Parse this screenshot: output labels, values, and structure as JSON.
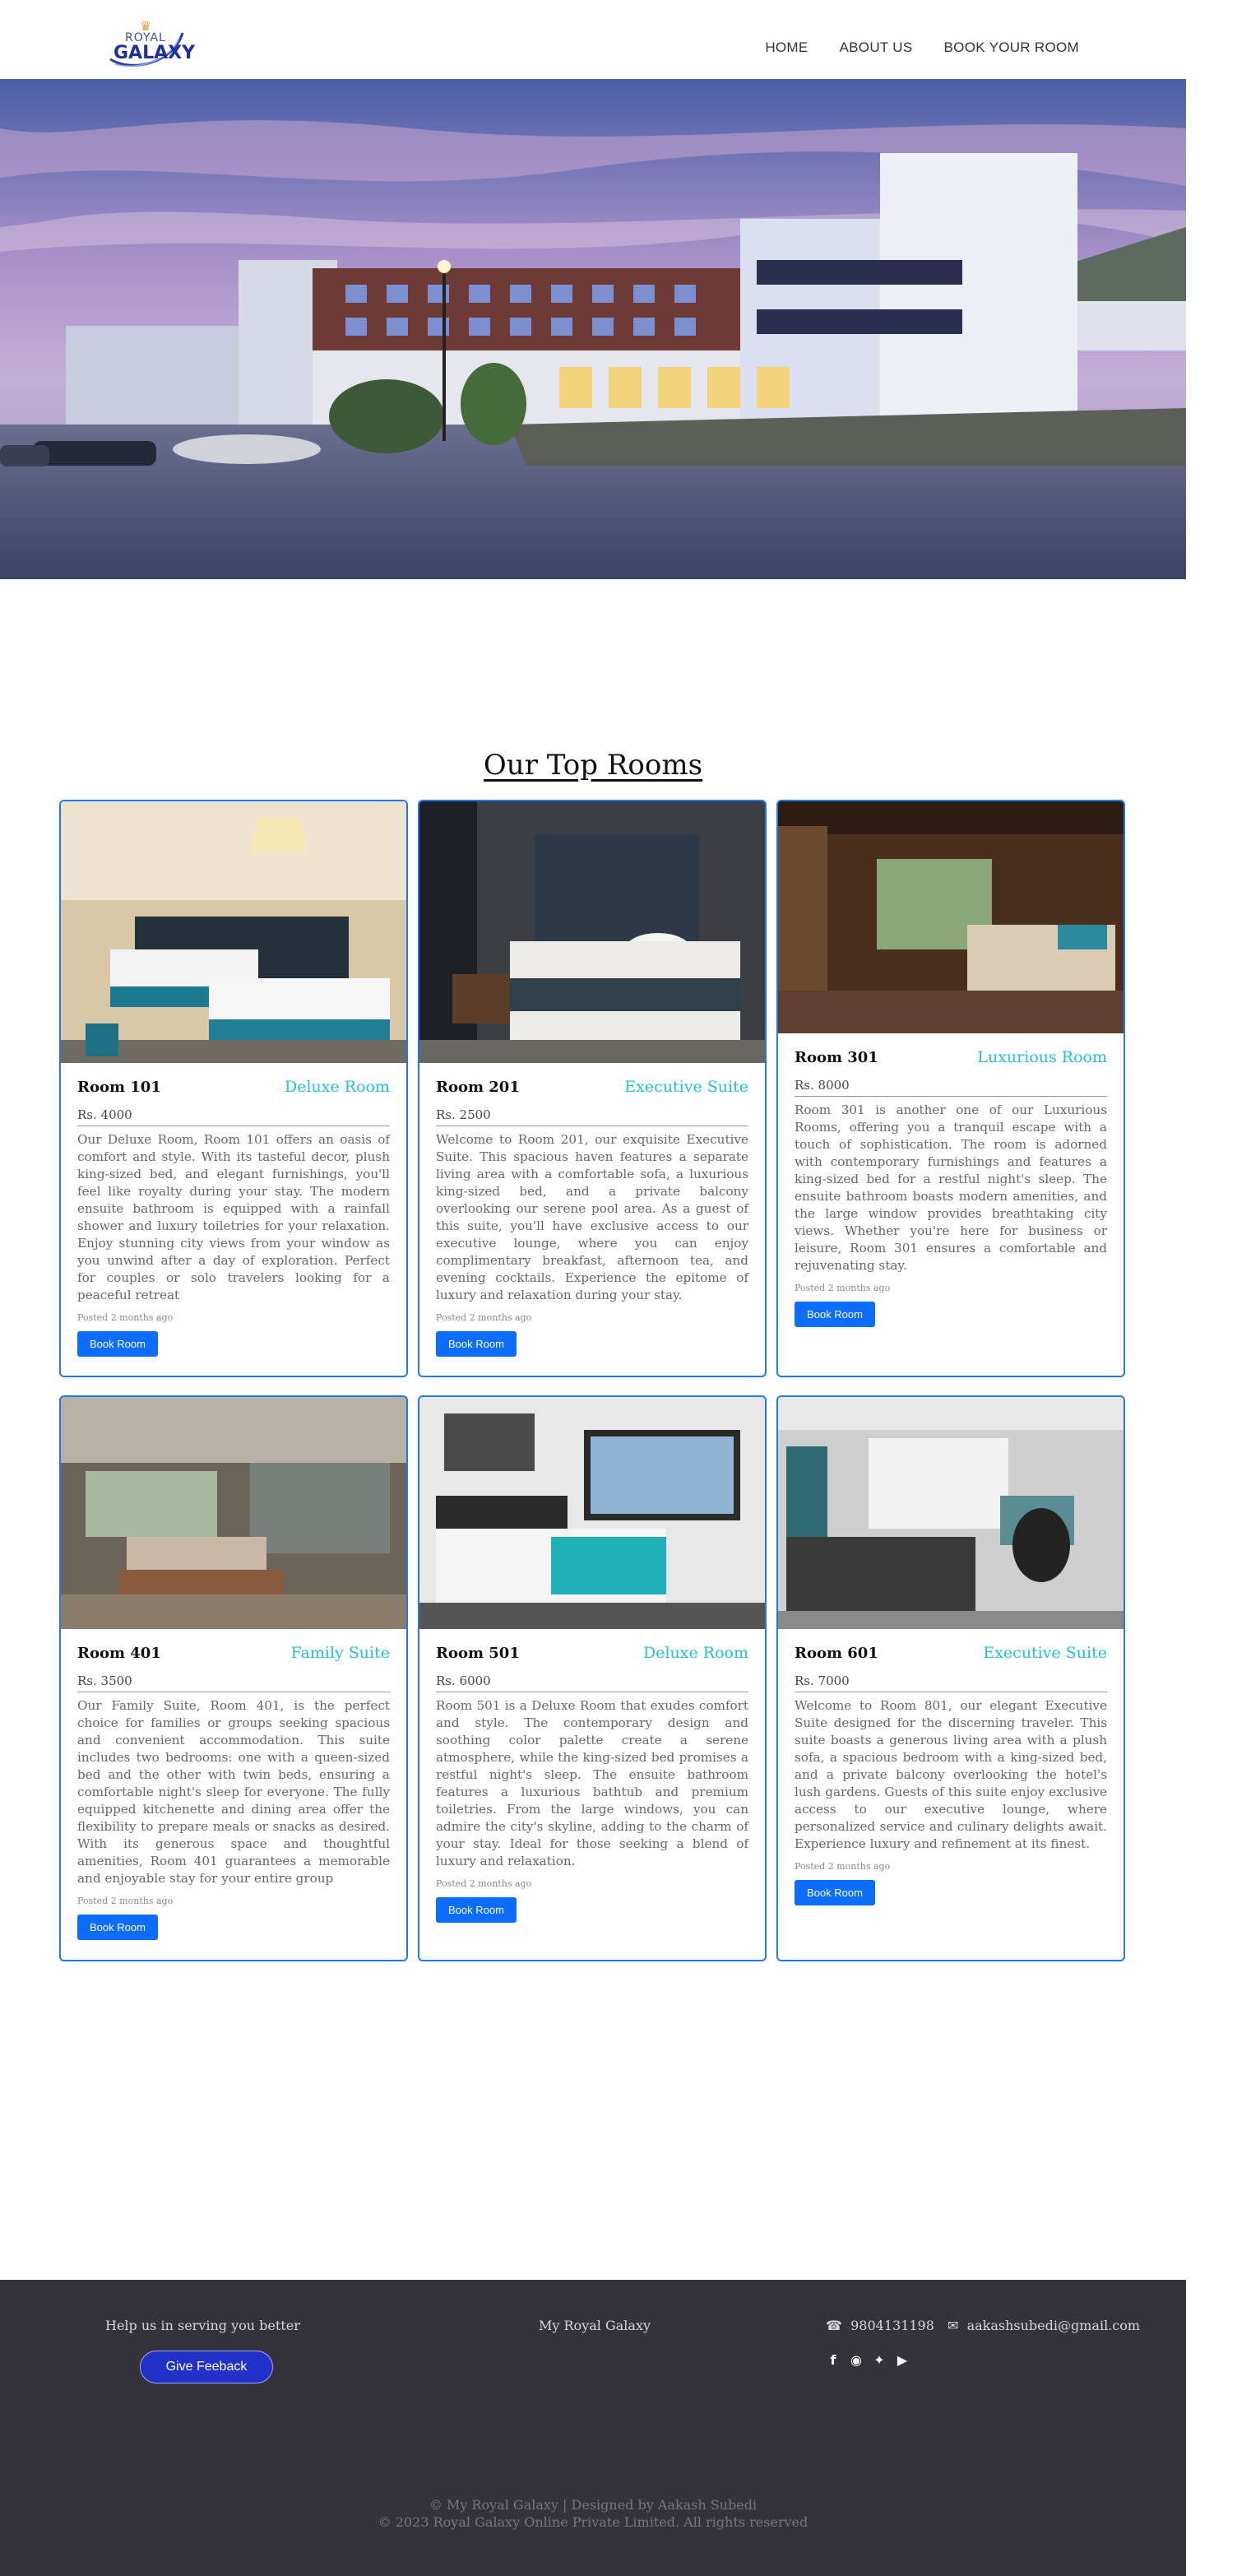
{
  "brand": {
    "logo_top": "ROYAL",
    "logo_bottom": "GALAXY"
  },
  "nav": {
    "items": [
      "HOME",
      "ABOUT US",
      "BOOK YOUR ROOM"
    ]
  },
  "hero": {
    "slides": 5
  },
  "section": {
    "title": "Our Top Rooms"
  },
  "rooms": [
    {
      "name": "Room 101",
      "type": "Deluxe Room",
      "price": "Rs. 4000",
      "description": "Our Deluxe Room, Room 101 offers an oasis of comfort and style. With its tasteful decor, plush king-sized bed, and elegant furnishings, you'll feel like royalty during your stay. The modern ensuite bathroom is equipped with a rainfall shower and luxury toiletries for your relaxation. Enjoy stunning city views from your window as you unwind after a day of exploration. Perfect for couples or solo travelers looking for a peaceful retreat",
      "posted": "Posted 2 months ago",
      "button": "Book Room"
    },
    {
      "name": "Room 201",
      "type": "Executive Suite",
      "price": "Rs. 2500",
      "description": "Welcome to Room 201, our exquisite Executive Suite. This spacious haven features a separate living area with a comfortable sofa, a luxurious king-sized bed, and a private balcony overlooking our serene pool area. As a guest of this suite, you'll have exclusive access to our executive lounge, where you can enjoy complimentary breakfast, afternoon tea, and evening cocktails. Experience the epitome of luxury and relaxation during your stay.",
      "posted": "Posted 2 months ago",
      "button": "Book Room"
    },
    {
      "name": "Room 301",
      "type": "Luxurious Room",
      "price": "Rs. 8000",
      "description": "Room 301 is another one of our Luxurious Rooms, offering you a tranquil escape with a touch of sophistication. The room is adorned with contemporary furnishings and features a king-sized bed for a restful night's sleep. The ensuite bathroom boasts modern amenities, and the large window provides breathtaking city views. Whether you're here for business or leisure, Room 301 ensures a comfortable and rejuvenating stay.",
      "posted": "Posted 2 months ago",
      "button": "Book Room"
    },
    {
      "name": "Room 401",
      "type": "Family Suite",
      "price": "Rs. 3500",
      "description": "Our Family Suite, Room 401, is the perfect choice for families or groups seeking spacious and convenient accommodation. This suite includes two bedrooms: one with a queen-sized bed and the other with twin beds, ensuring a comfortable night's sleep for everyone. The fully equipped kitchenette and dining area offer the flexibility to prepare meals or snacks as desired. With its generous space and thoughtful amenities, Room 401 guarantees a memorable and enjoyable stay for your entire group",
      "posted": "Posted 2 months ago",
      "button": "Book Room"
    },
    {
      "name": "Room 501",
      "type": "Deluxe Room",
      "price": "Rs. 6000",
      "description": "Room 501 is a Deluxe Room that exudes comfort and style. The contemporary design and soothing color palette create a serene atmosphere, while the king-sized bed promises a restful night's sleep. The ensuite bathroom features a luxurious bathtub and premium toiletries. From the large windows, you can admire the city's skyline, adding to the charm of your stay. Ideal for those seeking a blend of luxury and relaxation.",
      "posted": "Posted 2 months ago",
      "button": "Book Room"
    },
    {
      "name": "Room 601",
      "type": "Executive Suite",
      "price": "Rs. 7000",
      "description": "Welcome to Room 801, our elegant Executive Suite designed for the discerning traveler. This suite boasts a generous living area with a plush sofa, a spacious bedroom with a king-sized bed, and a private balcony overlooking the hotel's lush gardens. Guests of this suite enjoy exclusive access to our executive lounge, where personalized service and culinary delights await. Experience luxury and refinement at its finest.",
      "posted": "Posted 2 months ago",
      "button": "Book Room"
    }
  ],
  "footer": {
    "help_text": "Help us in serving you better",
    "feedback_button": "Give Feeback",
    "brand": "My Royal Galaxy",
    "phone": "9804131198",
    "email": "aakashsubedi@gmail.com",
    "social_icons": [
      "facebook-icon",
      "instagram-icon",
      "twitter-icon",
      "youtube-icon"
    ],
    "copyright_1": "© My Royal Galaxy | Designed by Aakash Subedi",
    "copyright_2": "© 2023 Royal Galaxy Online Private Limited. All rights reserved"
  },
  "colors": {
    "accent": "#22c1d6",
    "button": "#0d6efd",
    "card_border": "#1e7ae6",
    "footer_bg": "#34323b"
  }
}
